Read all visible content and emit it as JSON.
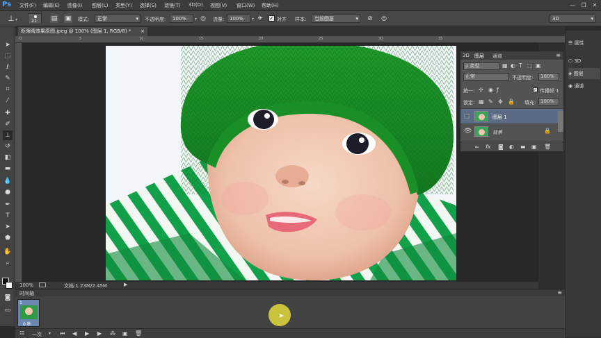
{
  "app": {
    "logo": "Ps"
  },
  "menu": [
    "文件(F)",
    "编辑(E)",
    "图像(I)",
    "图层(L)",
    "类型(Y)",
    "选择(S)",
    "滤镜(T)",
    "3D(D)",
    "视图(V)",
    "窗口(W)",
    "帮助(H)"
  ],
  "window_controls": {
    "minimize": "—",
    "restore": "❐",
    "close": "✕"
  },
  "options": {
    "brush_size": "21",
    "mode_label": "模式:",
    "mode_value": "正常",
    "opacity_label": "不透明度:",
    "opacity_value": "100%",
    "flow_label": "流量:",
    "flow_value": "100%",
    "align_label": "对齐",
    "sample_label": "样本:",
    "sample_value": "当前图层",
    "workspace": "3D"
  },
  "document": {
    "tab_label": "眨眼睛效果原图.jpeg @ 100% (图层 1, RGB/8) *",
    "zoom": "100%",
    "doc_size": "文档:1.23M/2.45M"
  },
  "ruler_ticks": [
    "0",
    "5",
    "10",
    "15",
    "20",
    "25",
    "30",
    "35"
  ],
  "layers_panel": {
    "tabs": [
      "3D",
      "图层",
      "通道"
    ],
    "filter_kind": "ρ 类型",
    "blend_mode": "正常",
    "opacity_label": "不透明度:",
    "opacity_value": "100%",
    "unify_label": "统一:",
    "propagate_label": "传播帧 1",
    "lock_label": "锁定:",
    "fill_label": "填充:",
    "fill_value": "100%",
    "layers": [
      {
        "name": "图层 1"
      },
      {
        "name": "背景"
      }
    ]
  },
  "right_dock": {
    "items": [
      {
        "label": "属性"
      },
      {
        "label": "3D"
      },
      {
        "label": "图层"
      },
      {
        "label": "通道"
      }
    ]
  },
  "timeline": {
    "title": "时间轴",
    "frame_number": "1",
    "frame_delay": "0 秒",
    "loop": "一次"
  },
  "colors": {
    "ui_dark": "#2b2b2b",
    "panel": "#535353",
    "selected_layer": "#5b6b86",
    "accent_logo": "#4fa3ff",
    "hat_green": "#2aa836"
  }
}
